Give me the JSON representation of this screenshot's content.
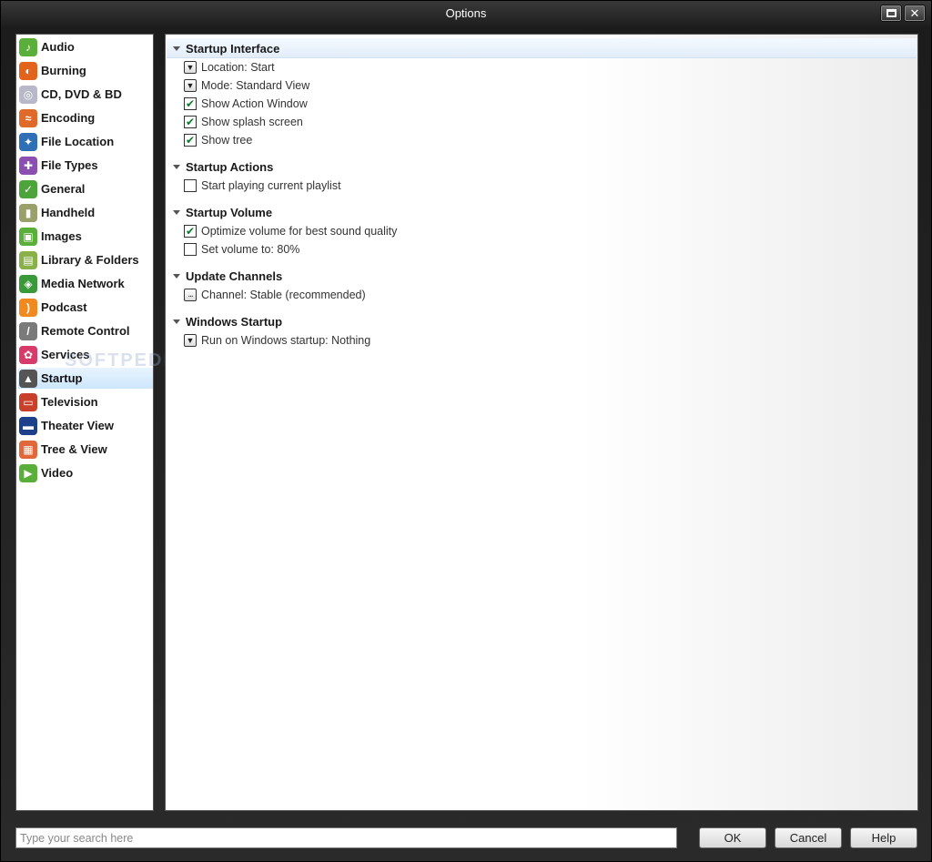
{
  "window": {
    "title": "Options"
  },
  "sidebar": {
    "items": [
      {
        "label": "Audio",
        "icon": "audio-icon",
        "color": "#5aae3a",
        "glyph": "♪"
      },
      {
        "label": "Burning",
        "icon": "burning-icon",
        "color": "#e2631c",
        "glyph": "◐"
      },
      {
        "label": "CD, DVD & BD",
        "icon": "disc-icon",
        "color": "#b8b8c8",
        "glyph": "◎"
      },
      {
        "label": "Encoding",
        "icon": "encoding-icon",
        "color": "#e06a2a",
        "glyph": "≈"
      },
      {
        "label": "File Location",
        "icon": "file-location-icon",
        "color": "#2f6fb5",
        "glyph": "✦"
      },
      {
        "label": "File Types",
        "icon": "file-types-icon",
        "color": "#8a4fb0",
        "glyph": "✚"
      },
      {
        "label": "General",
        "icon": "general-icon",
        "color": "#4ca43a",
        "glyph": "✓"
      },
      {
        "label": "Handheld",
        "icon": "handheld-icon",
        "color": "#9aa06a",
        "glyph": "▮"
      },
      {
        "label": "Images",
        "icon": "images-icon",
        "color": "#5aae3a",
        "glyph": "▣"
      },
      {
        "label": "Library & Folders",
        "icon": "library-icon",
        "color": "#8ab04a",
        "glyph": "▤"
      },
      {
        "label": "Media Network",
        "icon": "media-network-icon",
        "color": "#3a9a3a",
        "glyph": "◈"
      },
      {
        "label": "Podcast",
        "icon": "podcast-icon",
        "color": "#f08a20",
        "glyph": ")"
      },
      {
        "label": "Remote Control",
        "icon": "remote-control-icon",
        "color": "#7a7a7a",
        "glyph": "/"
      },
      {
        "label": "Services",
        "icon": "services-icon",
        "color": "#d83a6a",
        "glyph": "✿"
      },
      {
        "label": "Startup",
        "icon": "startup-icon",
        "color": "#555555",
        "glyph": "▲"
      },
      {
        "label": "Television",
        "icon": "television-icon",
        "color": "#c8402a",
        "glyph": "▭"
      },
      {
        "label": "Theater View",
        "icon": "theater-view-icon",
        "color": "#1e3f8a",
        "glyph": "▬"
      },
      {
        "label": "Tree & View",
        "icon": "tree-view-icon",
        "color": "#e0683a",
        "glyph": "▦"
      },
      {
        "label": "Video",
        "icon": "video-icon",
        "color": "#5aae3a",
        "glyph": "▶"
      }
    ],
    "selected": "Startup"
  },
  "sections": [
    {
      "title": "Startup Interface",
      "options": [
        {
          "label": "Location: Start",
          "kind": "dropdown"
        },
        {
          "label": "Mode: Standard View",
          "kind": "dropdown"
        },
        {
          "label": "Show Action Window",
          "kind": "checkbox",
          "checked": true
        },
        {
          "label": "Show splash screen",
          "kind": "checkbox",
          "checked": true
        },
        {
          "label": "Show tree",
          "kind": "checkbox",
          "checked": true
        }
      ]
    },
    {
      "title": "Startup Actions",
      "options": [
        {
          "label": "Start playing current playlist",
          "kind": "checkbox",
          "checked": false
        }
      ]
    },
    {
      "title": "Startup Volume",
      "options": [
        {
          "label": "Optimize volume for best sound quality",
          "kind": "checkbox",
          "checked": true
        },
        {
          "label": "Set volume to: 80%",
          "kind": "checkbox",
          "checked": false
        }
      ]
    },
    {
      "title": "Update Channels",
      "options": [
        {
          "label": "Channel: Stable (recommended)",
          "kind": "ellipsis"
        }
      ]
    },
    {
      "title": "Windows Startup",
      "options": [
        {
          "label": "Run on Windows startup: Nothing",
          "kind": "dropdown"
        }
      ]
    }
  ],
  "footer": {
    "search_placeholder": "Type your search here",
    "ok_label": "OK",
    "cancel_label": "Cancel",
    "help_label": "Help"
  },
  "watermark": "SOFTPEDIA"
}
